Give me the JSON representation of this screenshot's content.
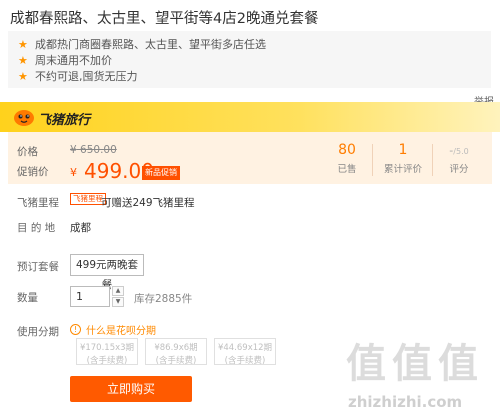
{
  "product": {
    "title": "成都春熙路、太古里、望平街等4店2晚通兑套餐",
    "highlights": [
      "成都热门商圈春熙路、太古里、望平街多店任选",
      "周末通用不加价",
      "不约可退,囤货无压力"
    ]
  },
  "report_label": "举报",
  "brand": {
    "name": "飞猪旅行",
    "color": "#ffd21c"
  },
  "price": {
    "original_label": "价格",
    "original_symbol": "¥",
    "original_value": "650.00",
    "promo_label": "促销价",
    "promo_symbol": "¥",
    "promo_value": "499.00",
    "promo_badge": "新品促销",
    "accent_color": "#ff5000"
  },
  "stats": [
    {
      "value": "80",
      "label": "已售"
    },
    {
      "value": "1",
      "label": "累计评价"
    },
    {
      "value": "-",
      "sub": "/5.0",
      "label": "评分"
    }
  ],
  "miles": {
    "label": "飞猪里程",
    "tag": "飞猪里程",
    "text": "可赠送249飞猪里程"
  },
  "destination": {
    "label": "目 的 地",
    "value": "成都"
  },
  "package": {
    "label": "预订套餐",
    "option": "499元两晚套餐"
  },
  "quantity": {
    "label": "数量",
    "value": "1",
    "up_icon": "▲",
    "down_icon": "▼",
    "stock": "库存2885件"
  },
  "installment": {
    "label": "使用分期",
    "help_icon": "!",
    "help_text": "什么是花呗分期",
    "options": [
      {
        "line1": "¥170.15x3期",
        "line2": "(含手续费)"
      },
      {
        "line1": "¥86.9x6期",
        "line2": "(含手续费)"
      },
      {
        "line1": "¥44.69x12期",
        "line2": "(含手续费)"
      }
    ]
  },
  "buy_button": "立即购买",
  "watermark": {
    "logo": "值值值",
    "url": "zhizhizhi.com"
  }
}
